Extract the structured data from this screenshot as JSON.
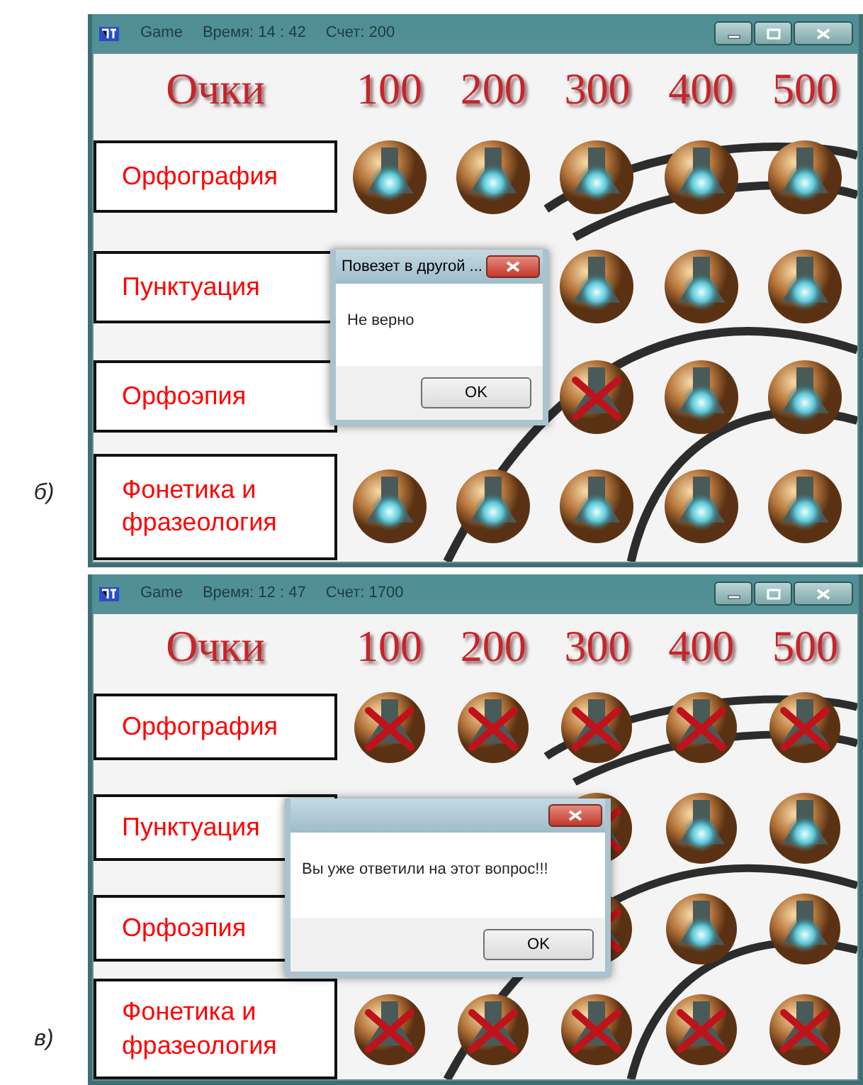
{
  "panels": [
    {
      "label": "б)",
      "window": {
        "app": "Game",
        "time": "Время: 14 : 42",
        "score": "Счет: 200"
      },
      "header": {
        "title": "Очки",
        "points": [
          "100",
          "200",
          "300",
          "400",
          "500"
        ]
      },
      "categories": [
        {
          "name": "Орфография",
          "cells": [
            {
              "answered": false
            },
            {
              "answered": false
            },
            {
              "answered": false
            },
            {
              "answered": false
            },
            {
              "answered": false
            }
          ]
        },
        {
          "name": "Пунктуация",
          "cells": [
            null,
            null,
            {
              "answered": false
            },
            {
              "answered": false
            },
            {
              "answered": false
            }
          ]
        },
        {
          "name": "Орфоэпия",
          "cells": [
            null,
            null,
            {
              "answered": true
            },
            {
              "answered": false
            },
            {
              "answered": false
            }
          ]
        },
        {
          "name": "Фонетика и фразеология",
          "cells": [
            {
              "answered": false
            },
            {
              "answered": false
            },
            {
              "answered": false
            },
            {
              "answered": false
            },
            {
              "answered": false
            }
          ]
        }
      ],
      "dialog": {
        "title": "Повезет в другой ...",
        "message": "Не верно",
        "button": "OK"
      }
    },
    {
      "label": "в)",
      "window": {
        "app": "Game",
        "time": "Время: 12 : 47",
        "score": "Счет: 1700"
      },
      "header": {
        "title": "Очки",
        "points": [
          "100",
          "200",
          "300",
          "400",
          "500"
        ]
      },
      "categories": [
        {
          "name": "Орфография",
          "cells": [
            {
              "answered": true
            },
            {
              "answered": true
            },
            {
              "answered": true
            },
            {
              "answered": true
            },
            {
              "answered": true
            }
          ]
        },
        {
          "name": "Пунктуация",
          "cells": [
            null,
            null,
            {
              "answered": true
            },
            {
              "answered": false
            },
            {
              "answered": false
            }
          ]
        },
        {
          "name": "Орфоэпия",
          "cells": [
            null,
            null,
            {
              "answered": true
            },
            {
              "answered": false
            },
            {
              "answered": false
            }
          ]
        },
        {
          "name": "Фонетика и фразеология",
          "cells": [
            {
              "answered": true
            },
            {
              "answered": true
            },
            {
              "answered": true
            },
            {
              "answered": true
            },
            {
              "answered": true
            }
          ]
        }
      ],
      "dialog": {
        "message": "Вы уже ответили на этот вопрос!!!",
        "button": "OK"
      }
    }
  ]
}
